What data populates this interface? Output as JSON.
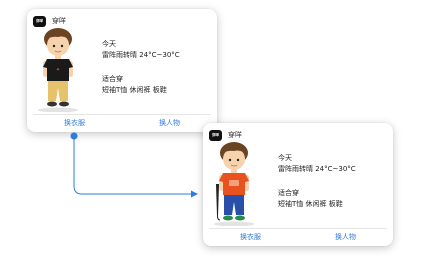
{
  "cards": [
    {
      "app_icon_text": "穿咩",
      "app_name": "穿咩",
      "day": "今天",
      "weather": "雷阵雨转晴 24°C~30°C",
      "suggest_title": "适合穿",
      "outfit": "短袖T恤 休闲裤 板鞋",
      "action_change_clothes": "换衣服",
      "action_change_person": "换人物",
      "shirt_color": "#1a1a1a",
      "pants_color": "#e6c26c"
    },
    {
      "app_icon_text": "穿咩",
      "app_name": "穿咩",
      "day": "今天",
      "weather": "雷阵雨转晴 24°C~30°C",
      "suggest_title": "适合穿",
      "outfit": "短袖T恤 休闲裤 板鞋",
      "action_change_clothes": "换衣服",
      "action_change_person": "换人物",
      "shirt_color": "#e8521f",
      "pants_color": "#2a4fa8"
    }
  ],
  "connector_color": "#2b7de0"
}
